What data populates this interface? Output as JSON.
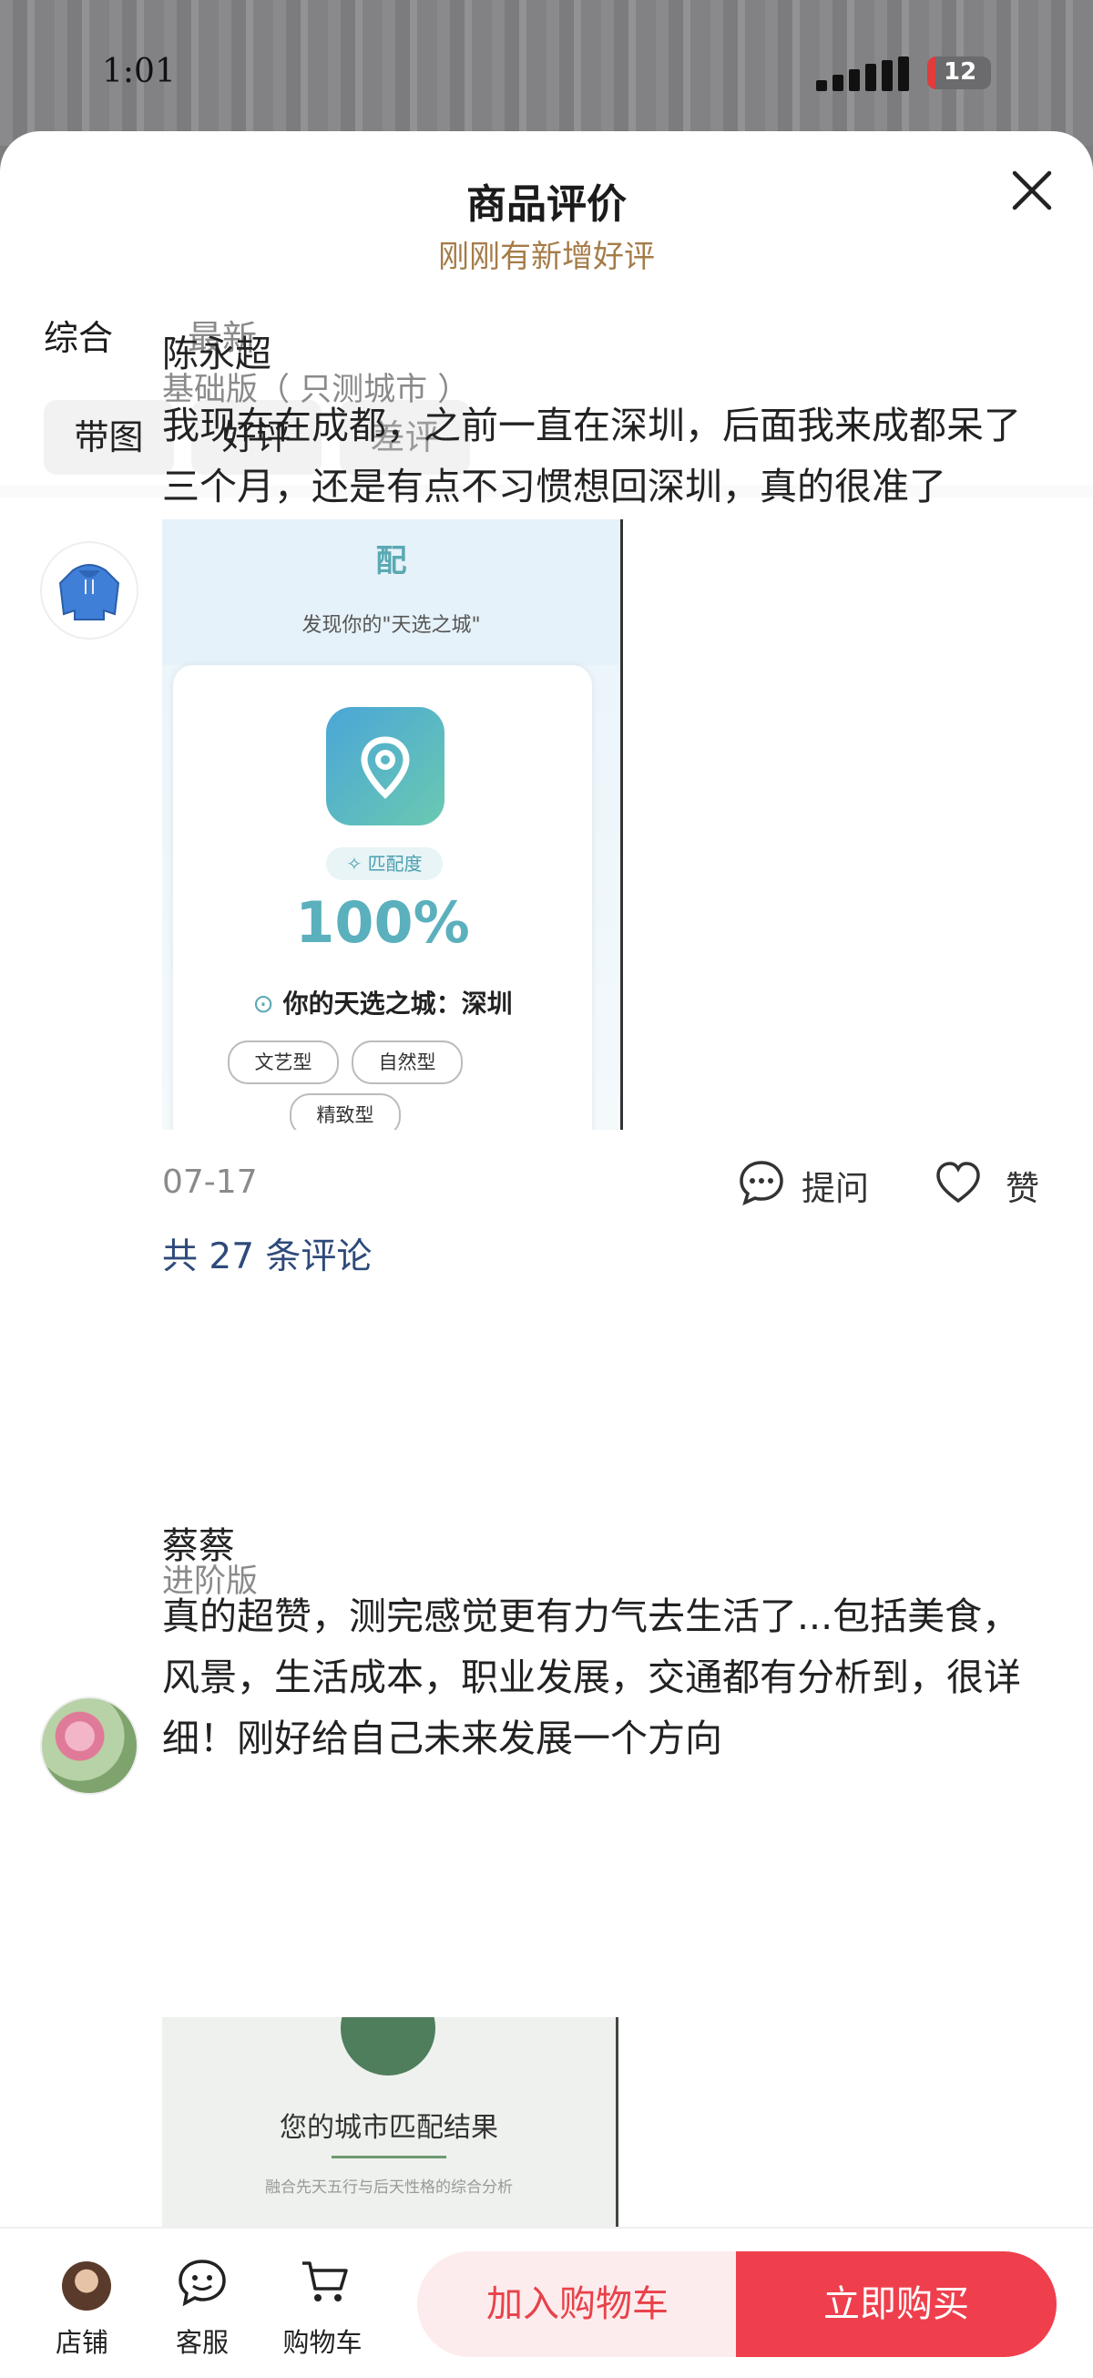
{
  "status_bar": {
    "time": "1:01",
    "battery": "12"
  },
  "header": {
    "title": "商品评价",
    "subtitle": "刚刚有新增好评"
  },
  "tabs": [
    {
      "label": "综合"
    },
    {
      "label": "最新"
    }
  ],
  "filters": [
    {
      "label": "带图"
    },
    {
      "label": "好评"
    },
    {
      "label": "差评"
    }
  ],
  "reviews": [
    {
      "user": "陈永超",
      "plan": "基础版（ 只测城市 ）",
      "text": "我现在在成都，之前一直在深圳，后面我来成都呆了三个月，还是有点不习惯想回深圳，真的很准了",
      "image": {
        "title_fragment": "配",
        "subtitle": "发现你的\"天选之城\"",
        "match_label": "匹配度",
        "percent": "100%",
        "city_line": "你的天选之城：深圳",
        "tags": [
          "文艺型",
          "自然型",
          "精致型"
        ]
      },
      "date": "07-17",
      "ask_label": "提问",
      "like_label": "赞",
      "comments": "共 27 条评论"
    },
    {
      "user": "蔡蔡",
      "plan": "进阶版",
      "text": "真的超赞，测完感觉更有力气去生活了...包括美食，风景，生活成本，职业发展，交通都有分析到，很详细！刚好给自己未来发展一个方向",
      "image": {
        "title": "您的城市匹配结果",
        "subtitle": "融合先天五行与后天性格的综合分析"
      }
    }
  ],
  "footer": {
    "store_label": "店铺",
    "service_label": "客服",
    "cart_label": "购物车",
    "add_to_cart": "加入购物车",
    "buy_now": "立即购买"
  },
  "colors": {
    "accent": "#ef3f4d",
    "subtitle": "#a57c48",
    "comment_link": "#2e4a7a"
  }
}
